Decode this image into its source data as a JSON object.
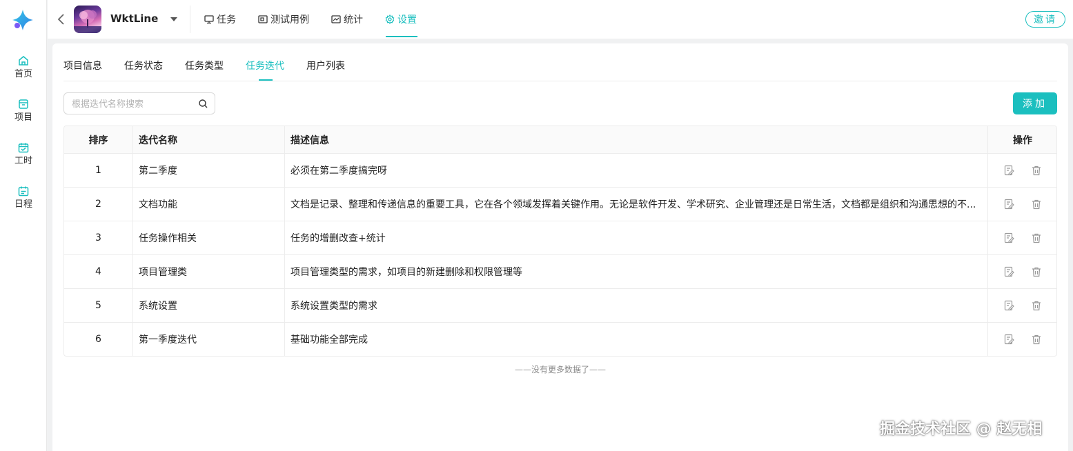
{
  "sidebar": {
    "items": [
      {
        "label": "首页",
        "icon": "home-icon"
      },
      {
        "label": "项目",
        "icon": "project-icon"
      },
      {
        "label": "工时",
        "icon": "calendar-check-icon"
      },
      {
        "label": "日程",
        "icon": "schedule-icon"
      }
    ]
  },
  "topbar": {
    "project_name": "WktLine",
    "nav": [
      {
        "label": "任务",
        "icon": "monitor-icon"
      },
      {
        "label": "测试用例",
        "icon": "testcase-icon"
      },
      {
        "label": "统计",
        "icon": "chart-icon"
      },
      {
        "label": "设置",
        "icon": "gear-icon",
        "active": true
      }
    ],
    "invite_label": "邀请"
  },
  "subtabs": [
    {
      "label": "项目信息"
    },
    {
      "label": "任务状态"
    },
    {
      "label": "任务类型"
    },
    {
      "label": "任务迭代",
      "active": true
    },
    {
      "label": "用户列表"
    }
  ],
  "search": {
    "placeholder": "根据迭代名称搜索",
    "value": ""
  },
  "add_label": "添加",
  "table": {
    "headers": [
      "排序",
      "迭代名称",
      "描述信息",
      "操作"
    ],
    "rows": [
      {
        "order": "1",
        "name": "第二季度",
        "desc": "必须在第二季度搞完呀"
      },
      {
        "order": "2",
        "name": "文档功能",
        "desc": "文档是记录、整理和传递信息的重要工具，它在各个领域发挥着关键作用。无论是软件开发、学术研究、企业管理还是日常生活，文档都是组织和沟通思想的不..."
      },
      {
        "order": "3",
        "name": "任务操作相关",
        "desc": "任务的增删改查+统计"
      },
      {
        "order": "4",
        "name": "项目管理类",
        "desc": "项目管理类型的需求，如项目的新建删除和权限管理等"
      },
      {
        "order": "5",
        "name": "系统设置",
        "desc": "系统设置类型的需求"
      },
      {
        "order": "6",
        "name": "第一季度迭代",
        "desc": "基础功能全部完成"
      }
    ]
  },
  "no_more_text": "——没有更多数据了——",
  "watermark": "掘金技术社区 @ 赵无相",
  "colors": {
    "accent": "#1bbfbf"
  }
}
